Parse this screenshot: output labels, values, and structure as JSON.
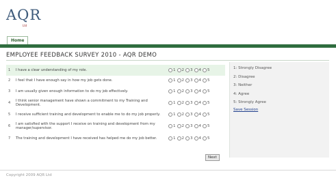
{
  "header": {
    "logo": "AQR",
    "logo_sub": "Ltd"
  },
  "nav": {
    "home_tab": "Home"
  },
  "survey": {
    "title": "EMPLOYEE FEEDBACK SURVEY 2010 - AQR DEMO",
    "questions": [
      {
        "num": "1",
        "text": "I have a clear understanding of my role."
      },
      {
        "num": "2",
        "text": "I feel that I have enough say in how my job gets done."
      },
      {
        "num": "3",
        "text": "I am usually given enough information to do my job effectively."
      },
      {
        "num": "4",
        "text": "I think senior management have shown a commitment to my Training and Development."
      },
      {
        "num": "5",
        "text": "I receive sufficient training and development to enable me to do my job properly."
      },
      {
        "num": "6",
        "text": "I am satisfied with the support I receive on training and development from my manager/supervisor."
      },
      {
        "num": "7",
        "text": "The training and development I have received has helped me do my job better."
      }
    ],
    "options": [
      "1",
      "2",
      "3",
      "4",
      "5"
    ],
    "next_label": "Next"
  },
  "legend": {
    "items": [
      "1: Strongly Disagree",
      "2: Disagree",
      "3: Neither",
      "4: Agree",
      "5: Strongly Agree"
    ],
    "save_session": "Save Session"
  },
  "footer": {
    "copyright": "Copyright 2009 AQR Ltd"
  },
  "colors": {
    "band": "#2f6d3f",
    "highlight": "#e7f4e7",
    "link": "#1f3e8c"
  }
}
